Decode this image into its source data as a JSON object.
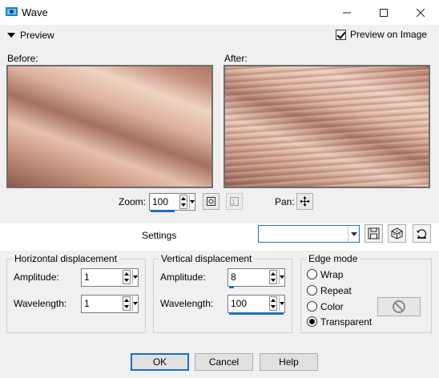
{
  "window": {
    "title": "Wave",
    "icon": "app-icon",
    "controls": {
      "minimize": "minimize-icon",
      "maximize": "maximize-icon",
      "close": "close-icon"
    }
  },
  "preview_bar": {
    "toggle_label": "Preview",
    "preview_on_image_label": "Preview on Image",
    "preview_on_image_checked": true
  },
  "preview": {
    "before_label": "Before:",
    "after_label": "After:",
    "zoom_label": "Zoom:",
    "zoom_value": "100",
    "pan_label": "Pan:",
    "icons": {
      "zoom_fit": "zoom-fit-icon",
      "zoom_actual": "zoom-actual-icon",
      "pan": "pan-move-icon"
    }
  },
  "settings": {
    "label": "Settings",
    "preset_value": "",
    "icons": {
      "save": "save-preset-icon",
      "randomize": "randomize-icon",
      "reset": "reset-icon"
    }
  },
  "horizontal": {
    "title": "Horizontal displacement",
    "amplitude_label": "Amplitude:",
    "amplitude_value": "1",
    "wavelength_label": "Wavelength:",
    "wavelength_value": "1"
  },
  "vertical": {
    "title": "Vertical displacement",
    "amplitude_label": "Amplitude:",
    "amplitude_value": "8",
    "wavelength_label": "Wavelength:",
    "wavelength_value": "100"
  },
  "edge_mode": {
    "title": "Edge mode",
    "options": [
      "Wrap",
      "Repeat",
      "Color",
      "Transparent"
    ],
    "selected": "Transparent",
    "color_icon": "no-color-icon"
  },
  "buttons": {
    "ok": "OK",
    "cancel": "Cancel",
    "help": "Help"
  },
  "colors": {
    "accent": "#1b6fc4",
    "panel": "#f0f0f0"
  }
}
